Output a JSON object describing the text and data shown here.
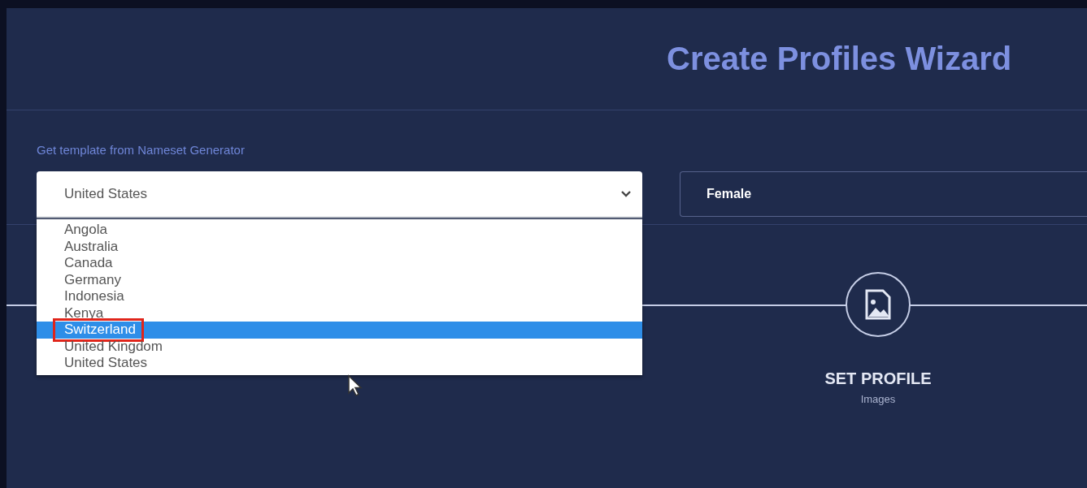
{
  "header": {
    "title": "Create Profiles Wizard"
  },
  "template": {
    "label": "Get template from Nameset Generator",
    "country": {
      "value": "United States",
      "expanded": true,
      "options": [
        {
          "label": "Angola",
          "highlighted": false,
          "annotated": false
        },
        {
          "label": "Australia",
          "highlighted": false,
          "annotated": false
        },
        {
          "label": "Canada",
          "highlighted": false,
          "annotated": false
        },
        {
          "label": "Germany",
          "highlighted": false,
          "annotated": false
        },
        {
          "label": "Indonesia",
          "highlighted": false,
          "annotated": false
        },
        {
          "label": "Kenya",
          "highlighted": false,
          "annotated": false
        },
        {
          "label": "Switzerland",
          "highlighted": true,
          "annotated": true
        },
        {
          "label": "United Kingdom",
          "highlighted": false,
          "annotated": false
        },
        {
          "label": "United States",
          "highlighted": false,
          "annotated": false
        }
      ]
    },
    "gender": {
      "value": "Female"
    }
  },
  "steps": [
    {
      "title": "SET PROFILE",
      "subtitle": "Images"
    }
  ]
}
